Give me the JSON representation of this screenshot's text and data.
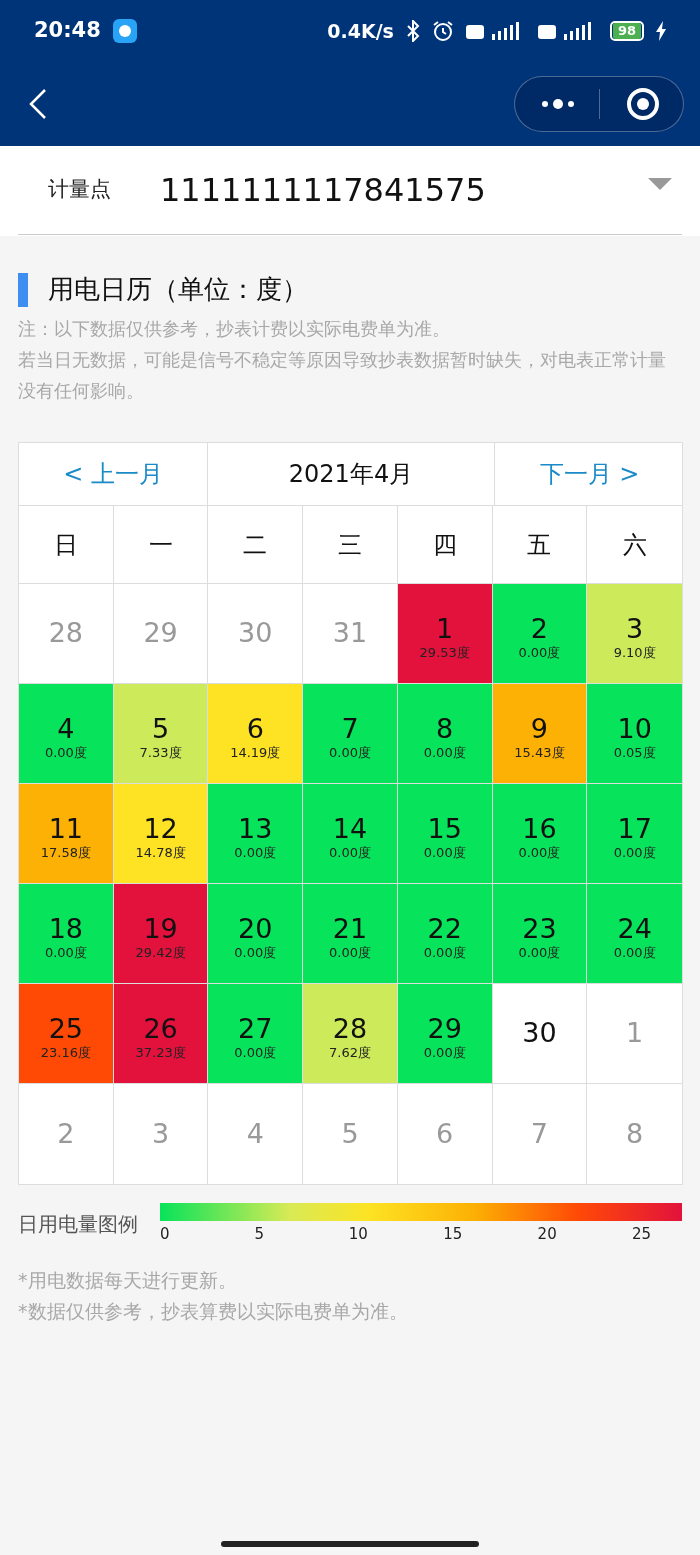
{
  "status_bar": {
    "time": "20:48",
    "net_speed": "0.4K/s",
    "battery": "98"
  },
  "meter_point": {
    "label": "计量点",
    "value": "1111111117841575"
  },
  "section": {
    "title": "用电日历（单位：度）",
    "notes": [
      "注：以下数据仅供参考，抄表计费以实际电费单为准。",
      "若当日无数据，可能是信号不稳定等原因导致抄表数据暂时缺失，对电表正常计量没有任何影响。"
    ]
  },
  "calendar": {
    "prev": "< 上一月",
    "month": "2021年4月",
    "next": "下一月 >",
    "weekdays": [
      "日",
      "一",
      "二",
      "三",
      "四",
      "五",
      "六"
    ],
    "days": [
      {
        "day": "28",
        "kind": "other"
      },
      {
        "day": "29",
        "kind": "other"
      },
      {
        "day": "30",
        "kind": "other"
      },
      {
        "day": "31",
        "kind": "other"
      },
      {
        "day": "1",
        "kind": "data",
        "usage": "29.53度",
        "color": "#e2123c"
      },
      {
        "day": "2",
        "kind": "data",
        "usage": "0.00度",
        "color": "#07e35a"
      },
      {
        "day": "3",
        "kind": "data",
        "usage": "9.10度",
        "color": "#cdea5a"
      },
      {
        "day": "4",
        "kind": "data",
        "usage": "0.00度",
        "color": "#07e35a"
      },
      {
        "day": "5",
        "kind": "data",
        "usage": "7.33度",
        "color": "#cdea5a"
      },
      {
        "day": "6",
        "kind": "data",
        "usage": "14.19度",
        "color": "#fde324"
      },
      {
        "day": "7",
        "kind": "data",
        "usage": "0.00度",
        "color": "#07e35a"
      },
      {
        "day": "8",
        "kind": "data",
        "usage": "0.00度",
        "color": "#07e35a"
      },
      {
        "day": "9",
        "kind": "data",
        "usage": "15.43度",
        "color": "#fcb104"
      },
      {
        "day": "10",
        "kind": "data",
        "usage": "0.05度",
        "color": "#07e35a"
      },
      {
        "day": "11",
        "kind": "data",
        "usage": "17.58度",
        "color": "#fcb104"
      },
      {
        "day": "12",
        "kind": "data",
        "usage": "14.78度",
        "color": "#fde324"
      },
      {
        "day": "13",
        "kind": "data",
        "usage": "0.00度",
        "color": "#07e35a"
      },
      {
        "day": "14",
        "kind": "data",
        "usage": "0.00度",
        "color": "#07e35a"
      },
      {
        "day": "15",
        "kind": "data",
        "usage": "0.00度",
        "color": "#07e35a"
      },
      {
        "day": "16",
        "kind": "data",
        "usage": "0.00度",
        "color": "#07e35a"
      },
      {
        "day": "17",
        "kind": "data",
        "usage": "0.00度",
        "color": "#07e35a"
      },
      {
        "day": "18",
        "kind": "data",
        "usage": "0.00度",
        "color": "#07e35a"
      },
      {
        "day": "19",
        "kind": "data",
        "usage": "29.42度",
        "color": "#e2123c"
      },
      {
        "day": "20",
        "kind": "data",
        "usage": "0.00度",
        "color": "#07e35a"
      },
      {
        "day": "21",
        "kind": "data",
        "usage": "0.00度",
        "color": "#07e35a"
      },
      {
        "day": "22",
        "kind": "data",
        "usage": "0.00度",
        "color": "#07e35a"
      },
      {
        "day": "23",
        "kind": "data",
        "usage": "0.00度",
        "color": "#07e35a"
      },
      {
        "day": "24",
        "kind": "data",
        "usage": "0.00度",
        "color": "#07e35a"
      },
      {
        "day": "25",
        "kind": "data",
        "usage": "23.16度",
        "color": "#ff4a06"
      },
      {
        "day": "26",
        "kind": "data",
        "usage": "37.23度",
        "color": "#e2123c"
      },
      {
        "day": "27",
        "kind": "data",
        "usage": "0.00度",
        "color": "#07e35a"
      },
      {
        "day": "28",
        "kind": "data",
        "usage": "7.62度",
        "color": "#cdea5a"
      },
      {
        "day": "29",
        "kind": "data",
        "usage": "0.00度",
        "color": "#07e35a"
      },
      {
        "day": "30",
        "kind": "empty"
      },
      {
        "day": "1",
        "kind": "other"
      },
      {
        "day": "2",
        "kind": "other"
      },
      {
        "day": "3",
        "kind": "other"
      },
      {
        "day": "4",
        "kind": "other"
      },
      {
        "day": "5",
        "kind": "other"
      },
      {
        "day": "6",
        "kind": "other"
      },
      {
        "day": "7",
        "kind": "other"
      },
      {
        "day": "8",
        "kind": "other"
      }
    ]
  },
  "legend": {
    "label": "日用电量图例",
    "ticks": [
      "0",
      "5",
      "10",
      "15",
      "20",
      "25"
    ]
  },
  "footnotes": [
    "*用电数据每天进行更新。",
    "*数据仅供参考，抄表算费以实际电费单为准。"
  ]
}
